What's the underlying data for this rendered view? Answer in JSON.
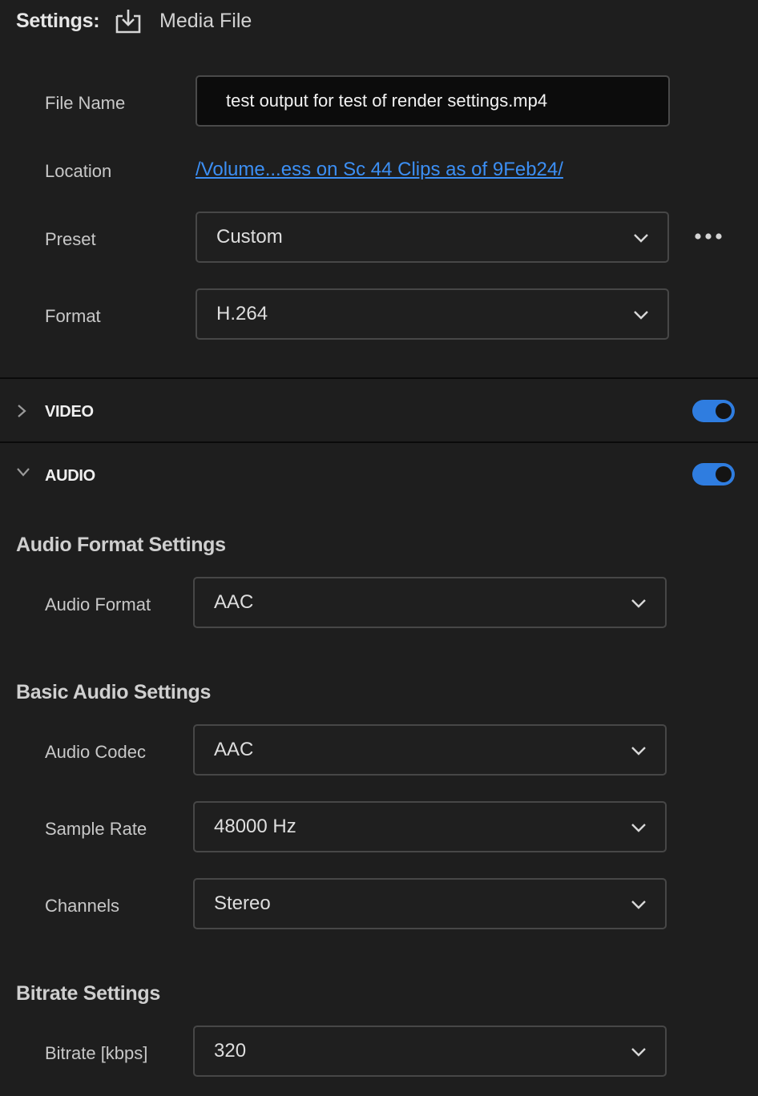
{
  "header": {
    "title": "Settings:",
    "subtitle": "Media File",
    "icon": "download-tray-icon"
  },
  "file_name": {
    "label": "File Name",
    "value": "test output for test of render settings.mp4"
  },
  "location": {
    "label": "Location",
    "value": "/Volume...ess on Sc 44 Clips as of 9Feb24/"
  },
  "preset": {
    "label": "Preset",
    "value": "Custom",
    "more_icon": "more-horizontal-icon"
  },
  "format": {
    "label": "Format",
    "value": "H.264"
  },
  "sections": {
    "video": {
      "label": "VIDEO",
      "enabled": true,
      "expanded": false
    },
    "audio": {
      "label": "AUDIO",
      "enabled": true,
      "expanded": true
    }
  },
  "audio_format_settings": {
    "heading": "Audio Format Settings",
    "audio_format": {
      "label": "Audio Format",
      "value": "AAC"
    }
  },
  "basic_audio_settings": {
    "heading": "Basic Audio Settings",
    "audio_codec": {
      "label": "Audio Codec",
      "value": "AAC"
    },
    "sample_rate": {
      "label": "Sample Rate",
      "value": "48000 Hz"
    },
    "channels": {
      "label": "Channels",
      "value": "Stereo"
    }
  },
  "bitrate_settings": {
    "heading": "Bitrate Settings",
    "bitrate": {
      "label": "Bitrate [kbps]",
      "value": "320"
    }
  },
  "colors": {
    "background": "#1e1e1e",
    "accent": "#2f7de0",
    "link": "#3c8ff4"
  }
}
